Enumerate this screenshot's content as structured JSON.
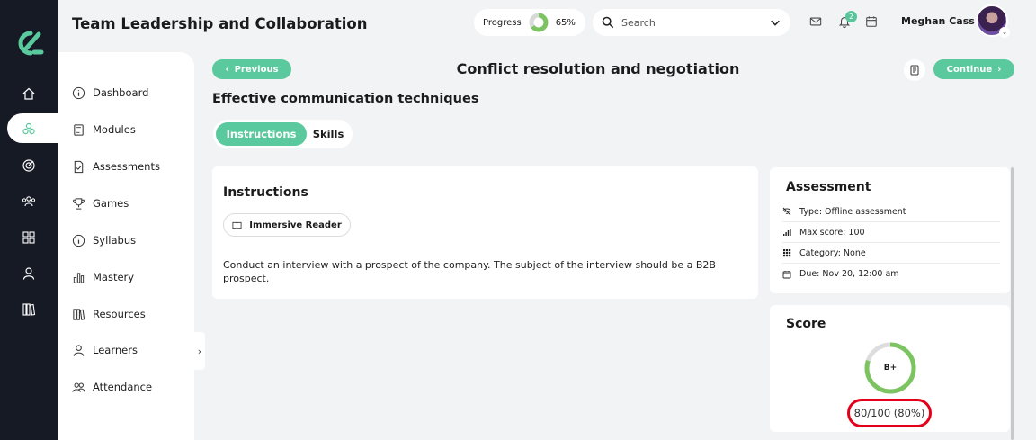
{
  "app": {
    "title": "Team Leadership and Collaboration"
  },
  "header": {
    "progress_label": "Progress",
    "progress_value": "65%",
    "progress_fraction": 0.65,
    "search_placeholder": "Search",
    "notification_count": "2",
    "user_name": "Meghan Cass"
  },
  "rail": {
    "icons": [
      "home-icon",
      "modules-nodes-icon",
      "target-icon",
      "people-icon",
      "grid-icon",
      "user-icon",
      "library-icon"
    ]
  },
  "sidebar": {
    "items": [
      {
        "label": "Dashboard",
        "icon": "info-circle-icon"
      },
      {
        "label": "Modules",
        "icon": "book-icon"
      },
      {
        "label": "Assessments",
        "icon": "file-check-icon"
      },
      {
        "label": "Games",
        "icon": "trophy-icon"
      },
      {
        "label": "Syllabus",
        "icon": "info-icon"
      },
      {
        "label": "Mastery",
        "icon": "bar-chart-icon"
      },
      {
        "label": "Resources",
        "icon": "books-icon"
      },
      {
        "label": "Learners",
        "icon": "person-icon"
      },
      {
        "label": "Attendance",
        "icon": "group-icon"
      }
    ]
  },
  "actions": {
    "previous_label": "Previous",
    "continue_label": "Continue"
  },
  "page": {
    "title": "Conflict resolution and negotiation",
    "section_title": "Effective communication techniques"
  },
  "tabs": [
    {
      "label": "Instructions",
      "active": true
    },
    {
      "label": "Skills",
      "active": false
    }
  ],
  "instructions": {
    "title": "Instructions",
    "reader_label": "Immersive Reader",
    "text": "Conduct an interview with a prospect of the company. The subject of the interview should be a B2B prospect."
  },
  "assessment": {
    "title": "Assessment",
    "rows": [
      {
        "icon": "wifi-off-icon",
        "text": "Type: Offline assessment"
      },
      {
        "icon": "signal-bars-icon",
        "text": "Max score: 100"
      },
      {
        "icon": "category-grid-icon",
        "text": "Category: None"
      },
      {
        "icon": "calendar-icon",
        "text": "Due: Nov 20, 12:00 am"
      }
    ]
  },
  "score": {
    "title": "Score",
    "grade": "B+",
    "text": "80/100 (80%)",
    "fraction": 0.8
  },
  "colors": {
    "accent": "#5ac99d",
    "rail_bg": "#151a24",
    "score_ring": "#7cc460",
    "highlight": "#e3001b"
  }
}
